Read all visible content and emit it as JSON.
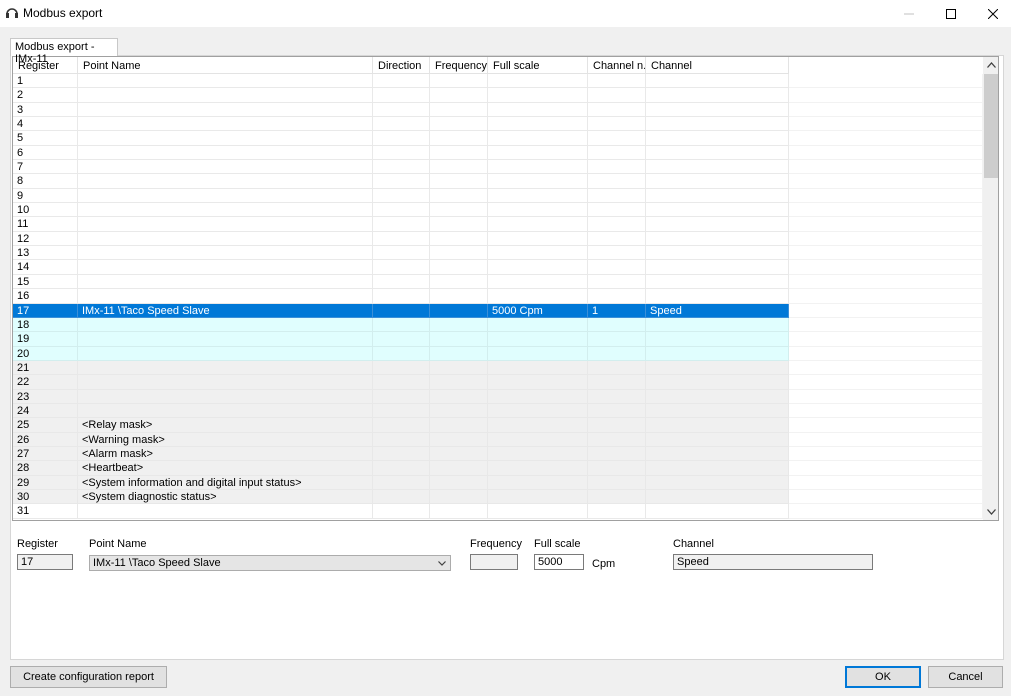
{
  "window": {
    "title": "Modbus export",
    "tab_label": "Modbus export - IMx-11"
  },
  "grid": {
    "columns": [
      "Register",
      "Point Name",
      "Direction",
      "Frequency",
      "Full scale",
      "Channel n...",
      "Channel"
    ],
    "rows": [
      {
        "register": "1",
        "point_name": "",
        "direction": "",
        "frequency": "",
        "full_scale": "",
        "channel_no": "",
        "channel": "",
        "style": "plain"
      },
      {
        "register": "2",
        "point_name": "",
        "direction": "",
        "frequency": "",
        "full_scale": "",
        "channel_no": "",
        "channel": "",
        "style": "plain"
      },
      {
        "register": "3",
        "point_name": "",
        "direction": "",
        "frequency": "",
        "full_scale": "",
        "channel_no": "",
        "channel": "",
        "style": "plain"
      },
      {
        "register": "4",
        "point_name": "",
        "direction": "",
        "frequency": "",
        "full_scale": "",
        "channel_no": "",
        "channel": "",
        "style": "plain"
      },
      {
        "register": "5",
        "point_name": "",
        "direction": "",
        "frequency": "",
        "full_scale": "",
        "channel_no": "",
        "channel": "",
        "style": "plain"
      },
      {
        "register": "6",
        "point_name": "",
        "direction": "",
        "frequency": "",
        "full_scale": "",
        "channel_no": "",
        "channel": "",
        "style": "plain"
      },
      {
        "register": "7",
        "point_name": "",
        "direction": "",
        "frequency": "",
        "full_scale": "",
        "channel_no": "",
        "channel": "",
        "style": "plain"
      },
      {
        "register": "8",
        "point_name": "",
        "direction": "",
        "frequency": "",
        "full_scale": "",
        "channel_no": "",
        "channel": "",
        "style": "plain"
      },
      {
        "register": "9",
        "point_name": "",
        "direction": "",
        "frequency": "",
        "full_scale": "",
        "channel_no": "",
        "channel": "",
        "style": "plain"
      },
      {
        "register": "10",
        "point_name": "",
        "direction": "",
        "frequency": "",
        "full_scale": "",
        "channel_no": "",
        "channel": "",
        "style": "plain"
      },
      {
        "register": "11",
        "point_name": "",
        "direction": "",
        "frequency": "",
        "full_scale": "",
        "channel_no": "",
        "channel": "",
        "style": "plain"
      },
      {
        "register": "12",
        "point_name": "",
        "direction": "",
        "frequency": "",
        "full_scale": "",
        "channel_no": "",
        "channel": "",
        "style": "plain"
      },
      {
        "register": "13",
        "point_name": "",
        "direction": "",
        "frequency": "",
        "full_scale": "",
        "channel_no": "",
        "channel": "",
        "style": "plain"
      },
      {
        "register": "14",
        "point_name": "",
        "direction": "",
        "frequency": "",
        "full_scale": "",
        "channel_no": "",
        "channel": "",
        "style": "plain"
      },
      {
        "register": "15",
        "point_name": "",
        "direction": "",
        "frequency": "",
        "full_scale": "",
        "channel_no": "",
        "channel": "",
        "style": "plain"
      },
      {
        "register": "16",
        "point_name": "",
        "direction": "",
        "frequency": "",
        "full_scale": "",
        "channel_no": "",
        "channel": "",
        "style": "plain"
      },
      {
        "register": "17",
        "point_name": "IMx-11 \\Taco Speed Slave",
        "direction": "",
        "frequency": "",
        "full_scale": "5000 Cpm",
        "channel_no": "1",
        "channel": "Speed",
        "style": "sel"
      },
      {
        "register": "18",
        "point_name": "",
        "direction": "",
        "frequency": "",
        "full_scale": "",
        "channel_no": "",
        "channel": "",
        "style": "aqua"
      },
      {
        "register": "19",
        "point_name": "",
        "direction": "",
        "frequency": "",
        "full_scale": "",
        "channel_no": "",
        "channel": "",
        "style": "aqua"
      },
      {
        "register": "20",
        "point_name": "",
        "direction": "",
        "frequency": "",
        "full_scale": "",
        "channel_no": "",
        "channel": "",
        "style": "aqua"
      },
      {
        "register": "21",
        "point_name": "",
        "direction": "",
        "frequency": "",
        "full_scale": "",
        "channel_no": "",
        "channel": "",
        "style": "gray"
      },
      {
        "register": "22",
        "point_name": "",
        "direction": "",
        "frequency": "",
        "full_scale": "",
        "channel_no": "",
        "channel": "",
        "style": "gray"
      },
      {
        "register": "23",
        "point_name": "",
        "direction": "",
        "frequency": "",
        "full_scale": "",
        "channel_no": "",
        "channel": "",
        "style": "gray"
      },
      {
        "register": "24",
        "point_name": "",
        "direction": "",
        "frequency": "",
        "full_scale": "",
        "channel_no": "",
        "channel": "",
        "style": "gray"
      },
      {
        "register": "25",
        "point_name": "<Relay mask>",
        "direction": "",
        "frequency": "",
        "full_scale": "",
        "channel_no": "",
        "channel": "",
        "style": "gray"
      },
      {
        "register": "26",
        "point_name": "<Warning mask>",
        "direction": "",
        "frequency": "",
        "full_scale": "",
        "channel_no": "",
        "channel": "",
        "style": "gray"
      },
      {
        "register": "27",
        "point_name": "<Alarm mask>",
        "direction": "",
        "frequency": "",
        "full_scale": "",
        "channel_no": "",
        "channel": "",
        "style": "gray"
      },
      {
        "register": "28",
        "point_name": "<Heartbeat>",
        "direction": "",
        "frequency": "",
        "full_scale": "",
        "channel_no": "",
        "channel": "",
        "style": "gray"
      },
      {
        "register": "29",
        "point_name": "<System information and digital input status>",
        "direction": "",
        "frequency": "",
        "full_scale": "",
        "channel_no": "",
        "channel": "",
        "style": "gray"
      },
      {
        "register": "30",
        "point_name": "<System diagnostic status>",
        "direction": "",
        "frequency": "",
        "full_scale": "",
        "channel_no": "",
        "channel": "",
        "style": "gray"
      },
      {
        "register": "31",
        "point_name": "",
        "direction": "",
        "frequency": "",
        "full_scale": "",
        "channel_no": "",
        "channel": "",
        "style": "plain"
      }
    ]
  },
  "editor": {
    "register_label": "Register",
    "register_value": "17",
    "point_name_label": "Point Name",
    "point_name_value": "IMx-11 \\Taco Speed Slave",
    "frequency_label": "Frequency",
    "frequency_value": "",
    "full_scale_label": "Full scale",
    "full_scale_value": "5000",
    "full_scale_unit": "Cpm",
    "channel_label": "Channel",
    "channel_value": "Speed"
  },
  "buttons": {
    "create_report": "Create configuration report",
    "ok": "OK",
    "cancel": "Cancel"
  },
  "colors": {
    "selection": "#0078d7",
    "highlight_rows": "#e0fefe",
    "reserved_rows": "#f0f0f0"
  }
}
